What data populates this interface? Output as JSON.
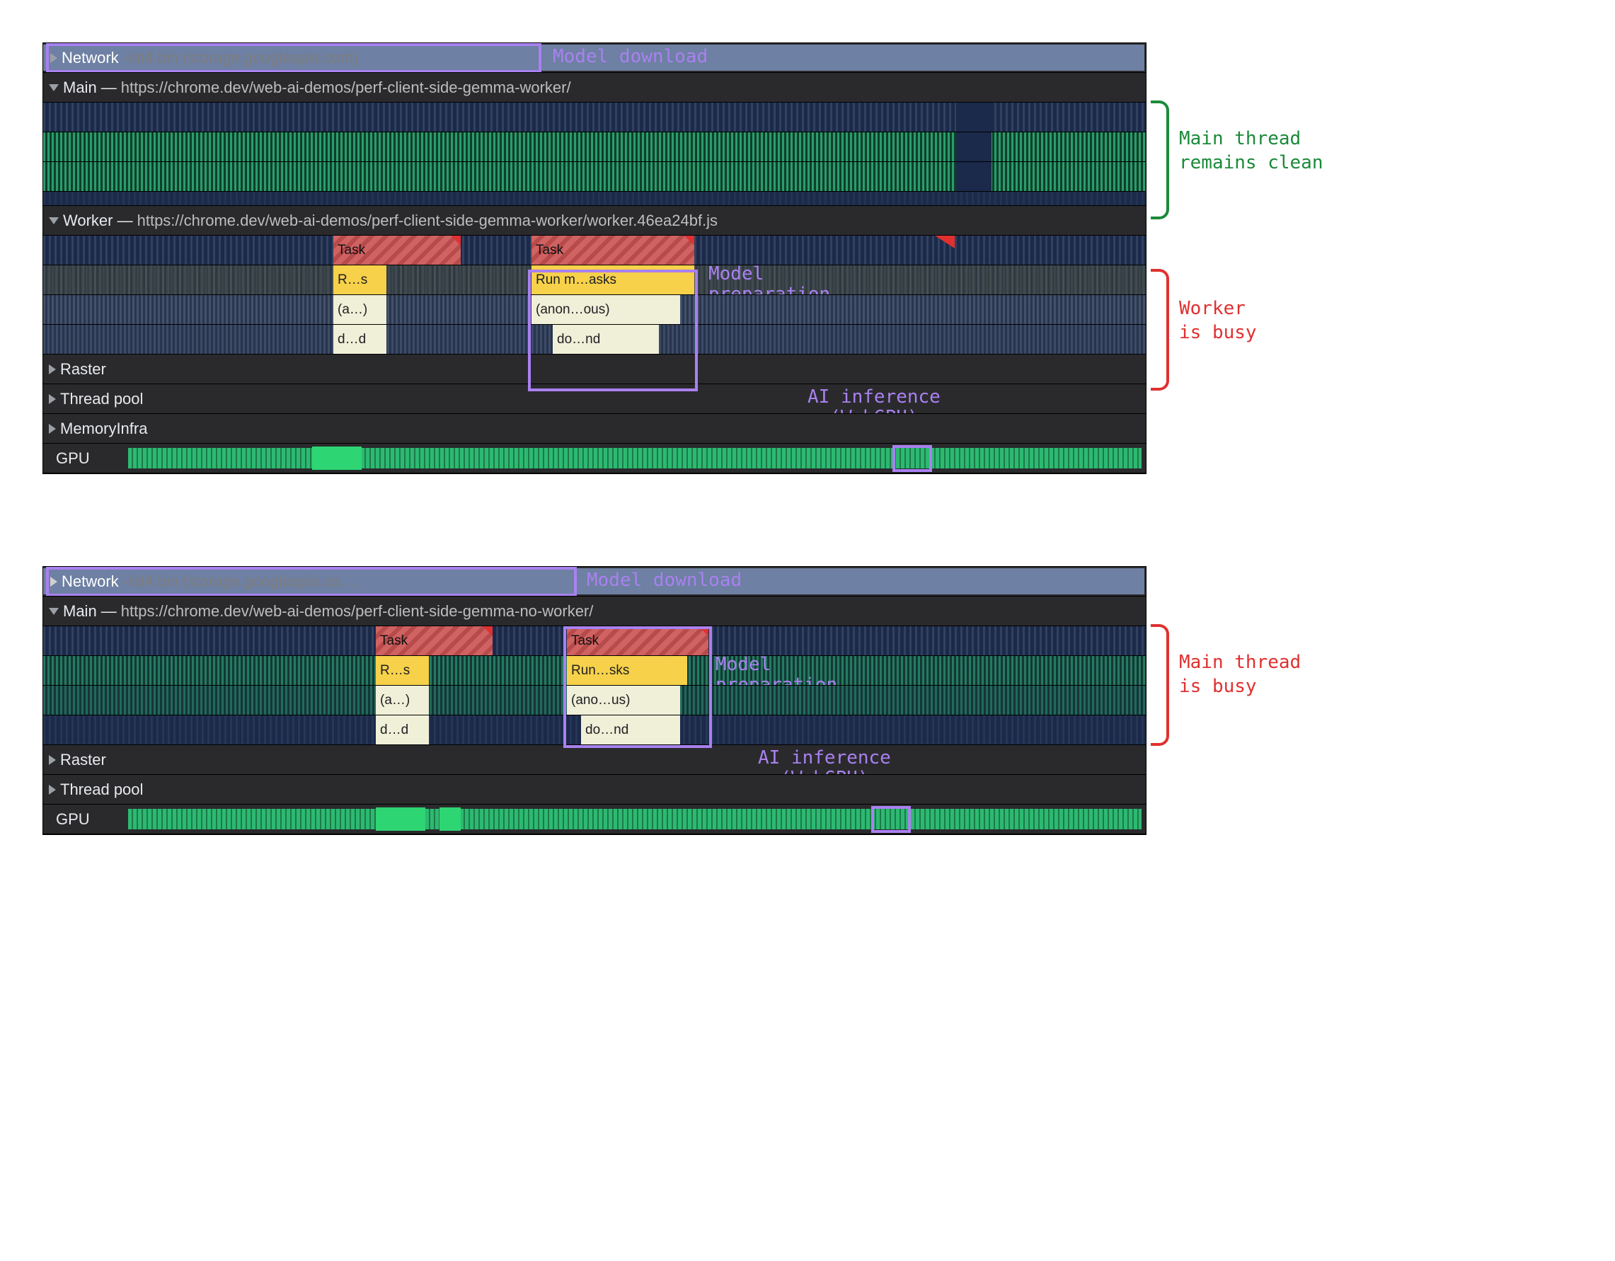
{
  "panel1": {
    "network": {
      "label": "Network",
      "file": "-int4.bin (storage.googleapis.com)",
      "annotation": "Model download"
    },
    "main": {
      "label": "Main —",
      "url": "https://chrome.dev/web-ai-demos/perf-client-side-gemma-worker/"
    },
    "worker": {
      "label": "Worker —",
      "url": "https://chrome.dev/web-ai-demos/perf-client-side-gemma-worker/worker.46ea24bf.js",
      "tasks": {
        "task1": "Task",
        "task2": "Task",
        "run1": "R…s",
        "run2": "Run m…asks",
        "anon1": "(a…)",
        "anon2": "(anon…ous)",
        "do1": "d…d",
        "do2": "do…nd"
      },
      "annotation": "Model\npreparation"
    },
    "raster": "Raster",
    "threadpool": "Thread pool",
    "memoryinfra": "MemoryInfra",
    "gpu": "GPU",
    "ai_annotation": "AI inference\n(WebGPU)",
    "side1": "Main thread\nremains clean",
    "side2": "Worker\nis busy"
  },
  "panel2": {
    "network": {
      "label": "Network",
      "file": "-int4.bin (storage.googleapis.co…",
      "annotation": "Model download"
    },
    "main": {
      "label": "Main —",
      "url": "https://chrome.dev/web-ai-demos/perf-client-side-gemma-no-worker/",
      "tasks": {
        "task1": "Task",
        "task2": "Task",
        "run1": "R…s",
        "run2": "Run…sks",
        "anon1": "(a…)",
        "anon2": "(ano…us)",
        "do1": "d…d",
        "do2": "do…nd"
      },
      "annotation": "Model\npreparation"
    },
    "raster": "Raster",
    "threadpool": "Thread pool",
    "gpu": "GPU",
    "ai_annotation": "AI inference\n(WebGPU)",
    "side1": "Main thread\nis busy"
  }
}
